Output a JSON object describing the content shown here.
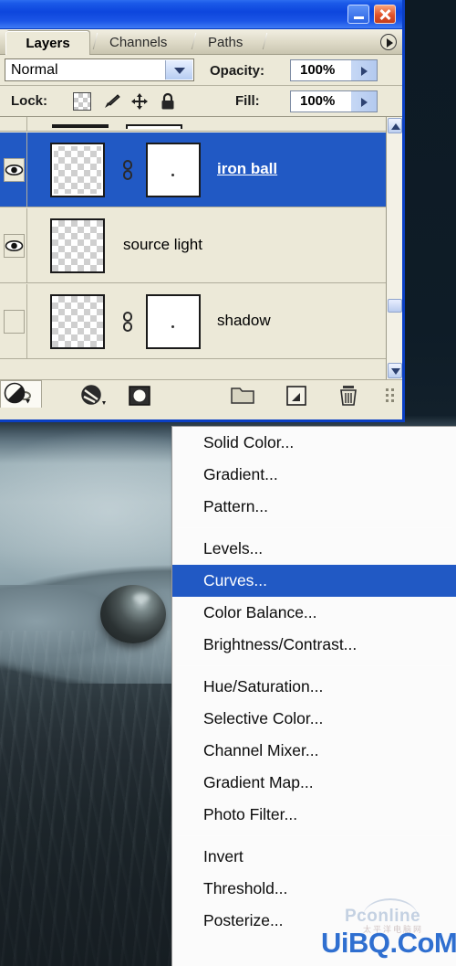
{
  "window": {
    "titlebar": {
      "minimize_label": "Minimize",
      "close_label": "Close"
    },
    "tabs": [
      {
        "label": "Layers",
        "active": true
      },
      {
        "label": "Channels",
        "active": false
      },
      {
        "label": "Paths",
        "active": false
      }
    ],
    "tab_menu_label": "Panel menu"
  },
  "options": {
    "blend_mode": "Normal",
    "opacity_label": "Opacity:",
    "opacity_value": "100%",
    "fill_label": "Fill:",
    "fill_value": "100%",
    "lock_label": "Lock:",
    "lock_icons": [
      "lock-transparent-pixels",
      "lock-image-pixels",
      "lock-position",
      "lock-all"
    ]
  },
  "layers": [
    {
      "name": "iron ball",
      "visible": true,
      "selected": true,
      "has_mask": true,
      "linked": true
    },
    {
      "name": "source light",
      "visible": true,
      "selected": false,
      "has_mask": false,
      "linked": false
    },
    {
      "name": "shadow",
      "visible": false,
      "selected": false,
      "has_mask": true,
      "linked": true
    }
  ],
  "footer_buttons": [
    {
      "name": "link-layers",
      "label": "Link layers"
    },
    {
      "name": "layer-style",
      "label": "Add a layer style"
    },
    {
      "name": "layer-mask",
      "label": "Add layer mask"
    },
    {
      "name": "adjustment-layer",
      "label": "Create new fill or adjustment layer"
    },
    {
      "name": "new-group",
      "label": "Create a new group"
    },
    {
      "name": "new-layer",
      "label": "Create a new layer"
    },
    {
      "name": "delete-layer",
      "label": "Delete layer"
    }
  ],
  "adjustment_menu": {
    "highlighted": "Curves...",
    "groups": [
      [
        "Solid Color...",
        "Gradient...",
        "Pattern..."
      ],
      [
        "Levels...",
        "Curves...",
        "Color Balance...",
        "Brightness/Contrast..."
      ],
      [
        "Hue/Saturation...",
        "Selective Color...",
        "Channel Mixer...",
        "Gradient Map...",
        "Photo Filter..."
      ],
      [
        "Invert",
        "Threshold...",
        "Posterize..."
      ]
    ]
  },
  "watermarks": {
    "pconline": "Pconline",
    "pconline_sub": "太平洋电脑网",
    "uibq": "UiBQ.CoM"
  },
  "colors": {
    "titlebar_blue": "#0d46dd",
    "selection_blue": "#2159c4",
    "panel_bg": "#ece9d8",
    "menu_bg": "#fbfbfb",
    "watermark_blue": "#2f6fd0"
  }
}
